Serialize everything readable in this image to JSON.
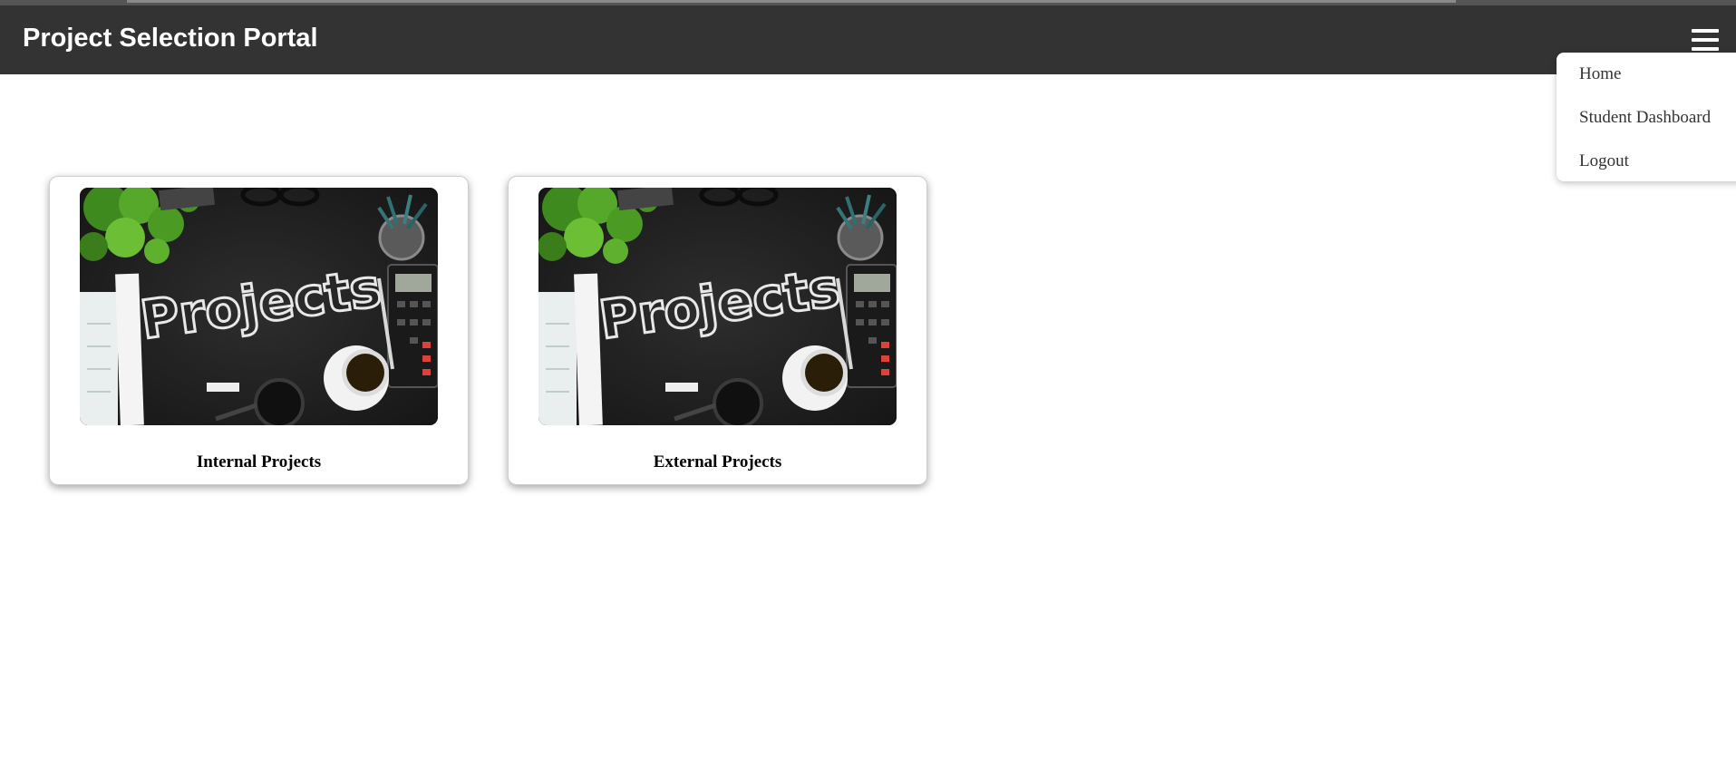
{
  "header": {
    "title": "Project Selection Portal",
    "menu_icon": "hamburger-menu-icon"
  },
  "menu": {
    "items": [
      {
        "label": "Home"
      },
      {
        "label": "Student Dashboard"
      },
      {
        "label": "Logout"
      }
    ]
  },
  "cards": [
    {
      "caption": "Internal Projects",
      "image_text": "Projects"
    },
    {
      "caption": "External Projects",
      "image_text": "Projects"
    }
  ],
  "colors": {
    "header_bg": "#333333",
    "header_text": "#ffffff",
    "page_bg": "#ffffff"
  }
}
